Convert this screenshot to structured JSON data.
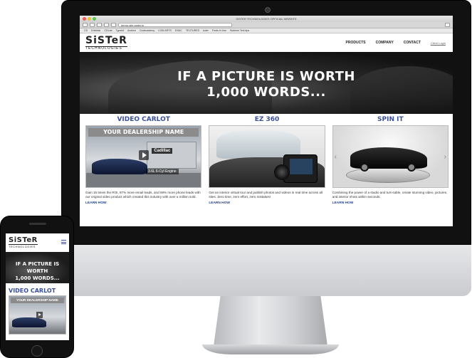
{
  "browser": {
    "window_title": "SISTER TECHNOLOGIES OFFICIAL WEBSITE",
    "url": "demo-site.sister.tv",
    "bookmarks": [
      "CS",
      "Dribbble",
      "CDLab",
      "Typekit",
      "Archive",
      "Codecademy",
      "COM ARTS",
      "DSAC",
      "TEXTURES",
      "kuler",
      "Fonts in Use",
      "Sublime Text tips"
    ]
  },
  "site": {
    "logo": {
      "main": "SiSTeR",
      "sub": "TECHNOLOGIES"
    },
    "nav": [
      "PRODUCTS",
      "COMPANY",
      "CONTACT"
    ],
    "login": "Client Login",
    "hero": {
      "line1": "IF A PICTURE IS WORTH",
      "line2": "1,000 WORDS..."
    },
    "products": [
      {
        "title": "VIDEO CARLOT",
        "image_banner": "YOUR DEALERSHIP NAME",
        "image_sign": "Cadillac",
        "image_tag": "3.6L 6-Cyl Engine",
        "text": "Gain 15 times the ROI, 87% more email leads, and 69% more phone leads with our original video product which created this industry with over a million sold.",
        "link": "LEARN HOW"
      },
      {
        "title": "EZ 360",
        "text": "Get an interior virtual tour and publish photos and videos in real time across all sites. Zero time, zero effort, zero mistakes!",
        "link": "LEARN HOW"
      },
      {
        "title": "SPIN IT",
        "text": "Combining the power of a studio and turn-table, create stunning video, pictures, and interior shots within seconds.",
        "link": "LEARN HOW"
      }
    ]
  },
  "mobile": {
    "logo": {
      "main": "SiSTeR",
      "sub": "TECHNOLOGIES"
    },
    "hero": {
      "line1": "IF A PICTURE IS WORTH",
      "line2": "1,000 WORDS..."
    },
    "product_title": "VIDEO CARLOT",
    "image_banner": "YOUR DEALERSHIP NAME"
  },
  "colors": {
    "accent": "#3a4f9a",
    "link": "#1f3f8f"
  }
}
